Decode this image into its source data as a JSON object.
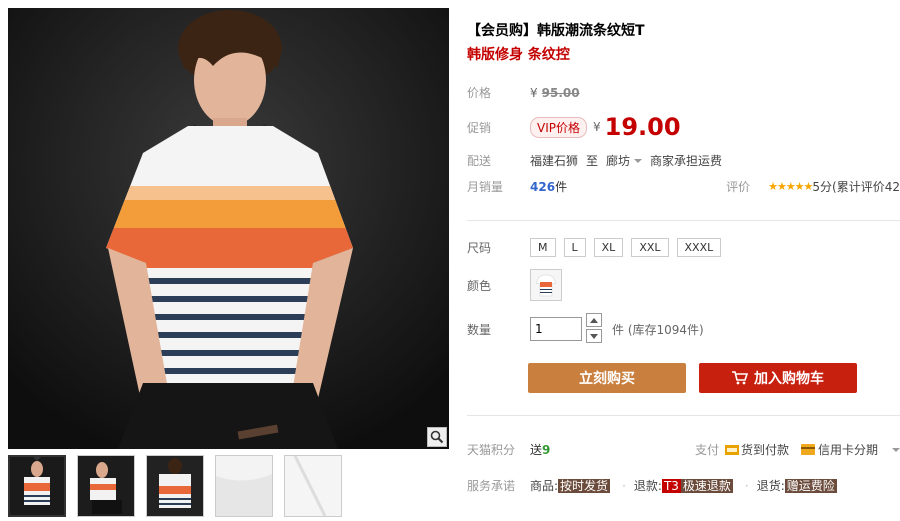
{
  "product": {
    "title": "【会员购】韩版潮流条纹短T",
    "subtitle": "韩版修身 条纹控"
  },
  "price": {
    "label": "价格",
    "currency": "¥",
    "original": "95.00"
  },
  "promo": {
    "label": "促销",
    "tag": "VIP价格",
    "currency": "¥",
    "value": "19.00"
  },
  "shipping": {
    "label": "配送",
    "from": "福建石狮",
    "to_word": "至",
    "to": "廊坊",
    "fee": "商家承担运费"
  },
  "sales": {
    "label": "月销量",
    "count": "426",
    "unit": "件",
    "rating_label": "评价",
    "rating_stars": 5,
    "rating_text": "5分(累计评价42"
  },
  "size": {
    "label": "尺码",
    "options": [
      "M",
      "L",
      "XL",
      "XXL",
      "XXXL"
    ]
  },
  "color": {
    "label": "颜色"
  },
  "quantity": {
    "label": "数量",
    "value": "1",
    "stock": "件 (库存1094件)"
  },
  "buttons": {
    "buy": "立刻购买",
    "cart": "加入购物车"
  },
  "points": {
    "label": "天猫积分",
    "text": "送",
    "value": "9"
  },
  "payment": {
    "label": "支付",
    "cod": "货到付款",
    "installment": "信用卡分期"
  },
  "service": {
    "label": "服务承诺",
    "item1_prefix": "商品:",
    "item1_tag": "按时发货",
    "item2_prefix": "退款:",
    "item2_badge": "T3",
    "item2_tag": "极速退款",
    "item3_prefix": "退货:",
    "item3_tag": "赠运费险"
  },
  "icons": {
    "zoom": "magnifier-icon",
    "cart": "cart-icon",
    "cod": "cash-on-delivery-icon",
    "card": "credit-card-icon"
  },
  "colors": {
    "price_red": "#c40000",
    "buy_button": "#c9803e",
    "cart_button": "#c8200f",
    "sales_blue": "#3366cc",
    "star": "#f7a500"
  }
}
